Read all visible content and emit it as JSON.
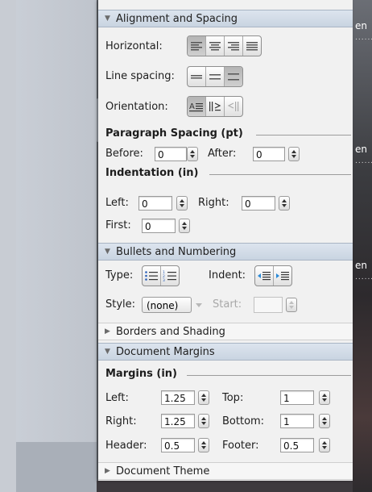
{
  "edge": {
    "text1": "en",
    "text2": "en",
    "text3": "en",
    "dots": "........"
  },
  "alignment": {
    "header": "Alignment and Spacing",
    "horizontal_label": "Horizontal:",
    "horizontal_selected": "align-left",
    "line_spacing_label": "Line spacing:",
    "line_spacing_selected": "double",
    "orientation_label": "Orientation:",
    "orientation_selected": "horizontal",
    "paragraph_spacing_title": "Paragraph Spacing (pt)",
    "before_label": "Before:",
    "before_value": "0",
    "after_label": "After:",
    "after_value": "0",
    "indentation_title": "Indentation (in)",
    "left_label": "Left:",
    "left_value": "0",
    "right_label": "Right:",
    "right_value": "0",
    "first_label": "First:",
    "first_value": "0"
  },
  "bullets": {
    "header": "Bullets and Numbering",
    "type_label": "Type:",
    "indent_label": "Indent:",
    "style_label": "Style:",
    "style_value": "(none)",
    "start_label": "Start:"
  },
  "borders": {
    "header": "Borders and Shading"
  },
  "margins": {
    "header": "Document Margins",
    "title": "Margins (in)",
    "left_label": "Left:",
    "left_value": "1.25",
    "top_label": "Top:",
    "top_value": "1",
    "right_label": "Right:",
    "right_value": "1.25",
    "bottom_label": "Bottom:",
    "bottom_value": "1",
    "header_label": "Header:",
    "header_value": "0.5",
    "footer_label": "Footer:",
    "footer_value": "0.5"
  },
  "theme": {
    "header": "Document Theme"
  },
  "colors": {
    "section_header": "#cdd6e2",
    "panel_bg": "#f1f1f1"
  }
}
